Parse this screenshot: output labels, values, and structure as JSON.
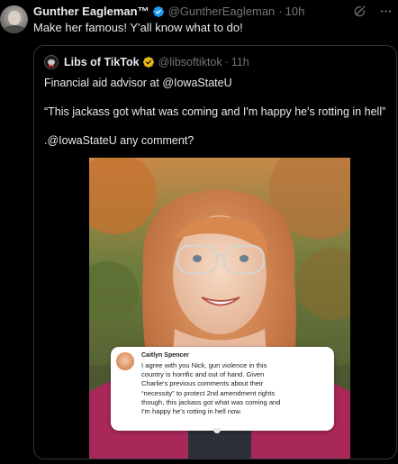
{
  "tweet": {
    "display_name": "Gunther Eagleman™",
    "handle": "@GuntherEagleman",
    "separator": "·",
    "time": "10h",
    "text": "Make her famous!  Y'all know what to do!",
    "icons": [
      "verified-badge-icon",
      "grok-icon",
      "more-icon"
    ]
  },
  "quote": {
    "display_name": "Libs of TikTok",
    "handle": "@libsoftiktok",
    "separator": "·",
    "time": "11h",
    "lines": [
      "Financial aid advisor at @IowaStateU",
      "“This jackass got what was coming and I'm happy he's rotting in hell”",
      ".@IowaStateU any comment?"
    ],
    "icons": [
      "gold-verified-badge-icon"
    ]
  },
  "comment": {
    "name": "Caitlyn Spencer",
    "lines": [
      "I agree with you Nick, gun violence in this",
      "country is horrific and out of hand. Given",
      "Charlie's previous comments about their",
      "“necessity” to protect 2nd amendment rights",
      "though, this jackass got what was coming and",
      "I'm happy he's rotting in hell now."
    ]
  },
  "colors": {
    "background": "#000000",
    "text": "#e7e9ea",
    "secondary": "#71767b",
    "border": "#2f3336",
    "verified_blue": "#1d9bf0",
    "verified_gold": "#e2b719"
  }
}
